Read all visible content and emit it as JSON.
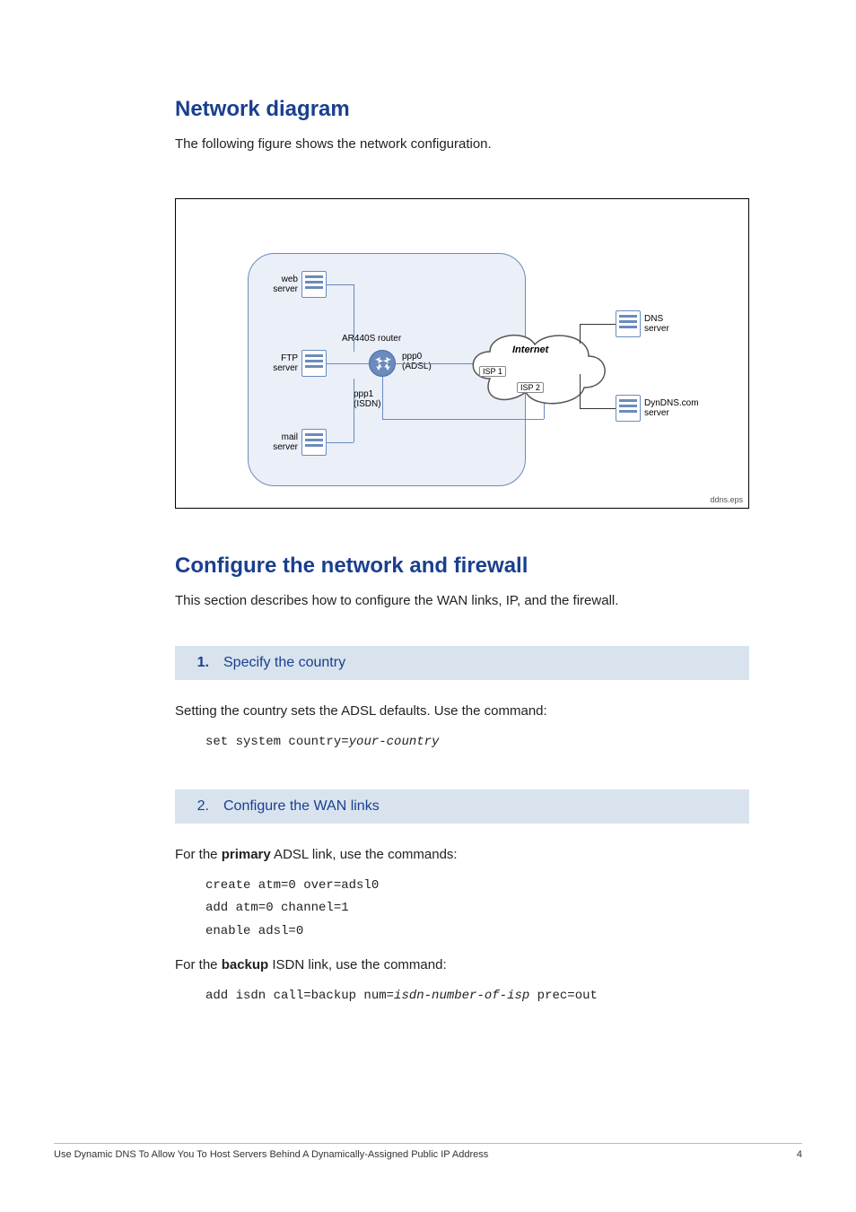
{
  "section1": {
    "heading": "Network diagram",
    "intro": "The following figure shows the network configuration."
  },
  "diagram": {
    "servers": {
      "web": {
        "label1": "web",
        "label2": "server"
      },
      "ftp": {
        "label1": "FTP",
        "label2": "server"
      },
      "mail": {
        "label1": "mail",
        "label2": "server"
      },
      "dns": {
        "label1": "DNS",
        "label2": "server"
      },
      "dyn": {
        "label1": "DynDNS.com",
        "label2": "server"
      }
    },
    "router_label": "AR440S router",
    "iface_ppp0_a": "ppp0",
    "iface_ppp0_b": "(ADSL)",
    "iface_ppp1_a": "ppp1",
    "iface_ppp1_b": "(ISDN)",
    "cloud_label": "Internet",
    "isp1": "ISP 1",
    "isp2": "ISP 2",
    "filename": "ddns.eps"
  },
  "section2": {
    "heading": "Configure the network and firewall",
    "intro": "This section describes how to configure the WAN links, IP, and the firewall."
  },
  "step1": {
    "num": "1.",
    "title": "Specify the country",
    "text": "Setting the country sets the ADSL defaults. Use the command:",
    "code_pre": "set system country=",
    "code_var": "your-country"
  },
  "step2": {
    "num": "2.",
    "title": "Configure the WAN links",
    "primary_pre": "For the ",
    "primary_bold": "primary",
    "primary_post": " ADSL link, use the commands:",
    "primary_code": "create atm=0 over=adsl0\nadd atm=0 channel=1\nenable adsl=0",
    "backup_pre": "For the ",
    "backup_bold": "backup",
    "backup_post": " ISDN link, use the command:",
    "backup_code_a": "add isdn call=backup num=",
    "backup_code_var": "isdn-number-of-isp",
    "backup_code_b": " prec=out"
  },
  "footer": {
    "title": "Use Dynamic DNS To Allow You To Host Servers Behind A Dynamically-Assigned Public IP Address",
    "page": "4"
  }
}
